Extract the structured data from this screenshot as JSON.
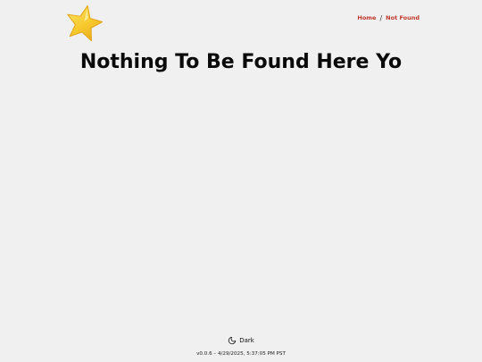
{
  "header": {
    "logo_icon": "star-icon",
    "breadcrumb": {
      "home_label": "Home",
      "separator": "/",
      "current_label": "Not Found"
    }
  },
  "main": {
    "title": "Nothing To Be Found Here Yo"
  },
  "footer": {
    "theme_toggle_icon": "moon-icon",
    "theme_toggle_label": "Dark",
    "version_text": "v0.0.6 – 4/29/2025, 5:37:05 PM PST"
  },
  "colors": {
    "background": "#f0f0f0",
    "breadcrumb_link": "#c0392b",
    "title": "#0a0a0a",
    "star_fill": "#f7c92e",
    "star_shade": "#e8a81a"
  }
}
